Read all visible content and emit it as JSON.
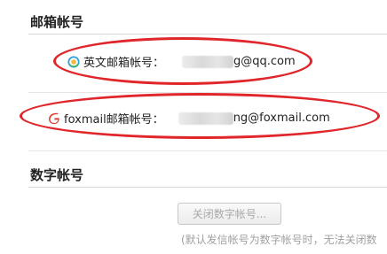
{
  "email_section": {
    "title": "邮箱帐号",
    "english_account": {
      "label": "英文邮箱帐号：",
      "value_visible": "g@qq.com",
      "icon": "qq-icon"
    },
    "foxmail_account": {
      "label": "foxmail邮箱帐号：",
      "value_visible": "ng@foxmail.com",
      "icon": "foxmail-icon"
    }
  },
  "digital_section": {
    "title": "数字帐号",
    "close_button": "关闭数字帐号...",
    "note": "(默认发信帐号为数字帐号时，无法关闭数"
  },
  "colors": {
    "annotation": "#e0262b",
    "foxmail": "#e23b2e",
    "qq_ring": "#2aa0e0"
  }
}
